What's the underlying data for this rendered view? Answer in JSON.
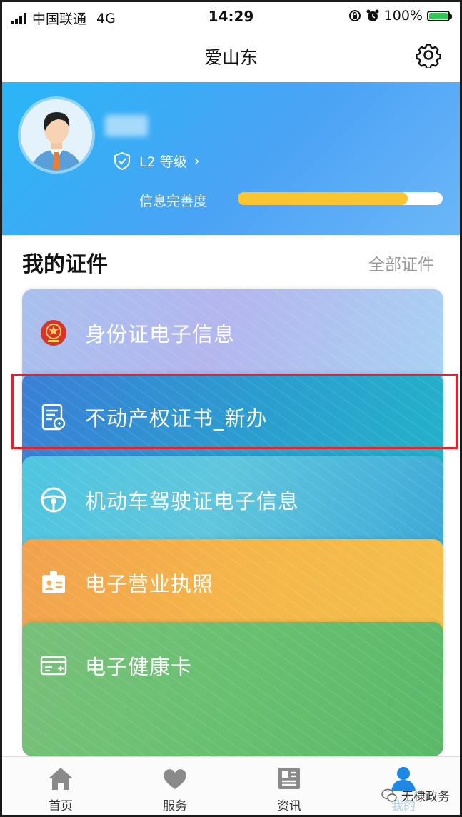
{
  "status_bar": {
    "carrier": "中国联通",
    "network": "4G",
    "time": "14:29",
    "battery": "100%"
  },
  "nav": {
    "title": "爱山东",
    "settings_icon": "gear-icon"
  },
  "profile": {
    "level_label": "L2 等级",
    "completeness_label": "信息完善度",
    "completeness_fraction": 0.83
  },
  "section": {
    "title": "我的证件",
    "all_link": "全部证件"
  },
  "cards": [
    {
      "label": "身份证电子信息",
      "icon": "national-emblem-icon",
      "color": "#b0b8ee"
    },
    {
      "label": "不动产权证书_新办",
      "icon": "certificate-document-icon",
      "color": "#2f8fd3"
    },
    {
      "label": "机动车驾驶证电子信息",
      "icon": "steering-wheel-icon",
      "color": "#4fc3df"
    },
    {
      "label": "电子营业执照",
      "icon": "business-license-icon",
      "color": "#f4b04a"
    },
    {
      "label": "电子健康卡",
      "icon": "health-card-icon",
      "color": "#6fbf75"
    }
  ],
  "highlight_color": "#e1242b",
  "tabs": [
    {
      "label": "首页",
      "icon": "home-icon"
    },
    {
      "label": "服务",
      "icon": "heart-icon"
    },
    {
      "label": "资讯",
      "icon": "news-icon"
    },
    {
      "label": "我的",
      "icon": "user-icon"
    }
  ],
  "watermark": "无棣政务"
}
